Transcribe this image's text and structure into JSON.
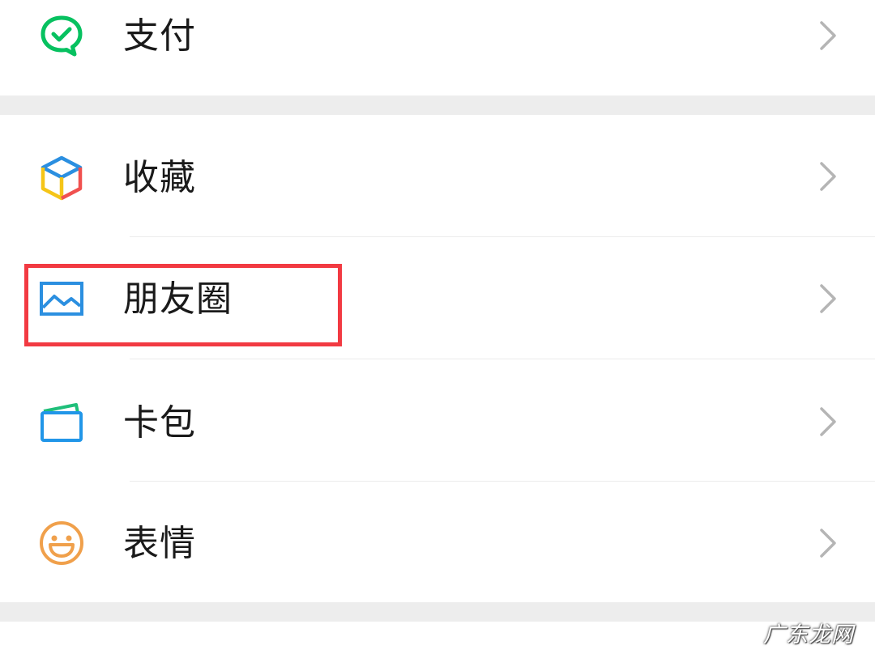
{
  "menu": {
    "items": [
      {
        "label": "支付",
        "icon": "wechat-pay-icon"
      },
      {
        "label": "收藏",
        "icon": "favorites-cube-icon"
      },
      {
        "label": "朋友圈",
        "icon": "moments-picture-icon"
      },
      {
        "label": "卡包",
        "icon": "card-wallet-icon"
      },
      {
        "label": "表情",
        "icon": "smiley-face-icon"
      }
    ]
  },
  "annotation": {
    "highlighted_item": "朋友圈",
    "color": "#f23a42"
  },
  "watermark": {
    "text": "广东龙网"
  },
  "colors": {
    "background": "#ededed",
    "row_background": "#ffffff",
    "pay_green": "#07c160",
    "moments_blue": "#2b8fe0",
    "card_green": "#1fbf7a",
    "card_blue": "#2196e8",
    "smiley_orange": "#f0a04b",
    "chevron_gray": "#b5b5b5"
  }
}
